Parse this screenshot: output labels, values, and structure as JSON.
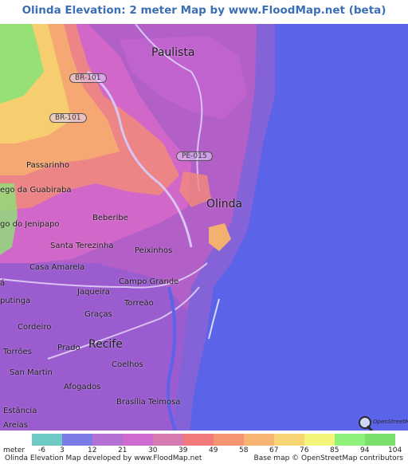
{
  "title": "Olinda Elevation: 2 meter Map by www.FloodMap.net (beta)",
  "map": {
    "places": [
      {
        "id": "paulista",
        "label": "Paulista"
      },
      {
        "id": "passarinho",
        "label": "Passarinho"
      },
      {
        "id": "corrego-guabiraba",
        "label": "ego da Guabiraba"
      },
      {
        "id": "corrego-jenipapo",
        "label": "go do Jenipapo"
      },
      {
        "id": "olinda",
        "label": "Olinda"
      },
      {
        "id": "beberibe",
        "label": "Beberibe"
      },
      {
        "id": "santa-terezinha",
        "label": "Santa Terezinha"
      },
      {
        "id": "peixinhos",
        "label": "Peixinhos"
      },
      {
        "id": "casa-amarela",
        "label": "Casa Amarela"
      },
      {
        "id": "campo-grande",
        "label": "Campo Grande"
      },
      {
        "id": "jaqueira",
        "label": "Jaqueira"
      },
      {
        "id": "apipucos",
        "label": "putinga"
      },
      {
        "id": "torreao",
        "label": "Torreão"
      },
      {
        "id": "cordeiro",
        "label": "Cordeiro"
      },
      {
        "id": "gracas",
        "label": "Graças"
      },
      {
        "id": "torroes",
        "label": "Torrões"
      },
      {
        "id": "prado",
        "label": "Prado"
      },
      {
        "id": "recife",
        "label": "Recife"
      },
      {
        "id": "san-martin",
        "label": "San Martin"
      },
      {
        "id": "coelhos",
        "label": "Coelhos"
      },
      {
        "id": "afogados",
        "label": "Afogados"
      },
      {
        "id": "estancia",
        "label": "Estância"
      },
      {
        "id": "brasilia-teimosa",
        "label": "Brasília Teimosa"
      },
      {
        "id": "areias",
        "label": "Areias"
      },
      {
        "id": "edge-a",
        "label": "á"
      }
    ],
    "road_shields": [
      {
        "id": "br101-north",
        "label": "BR-101"
      },
      {
        "id": "br101-south",
        "label": "BR-101"
      },
      {
        "id": "pe015",
        "label": "PE-015"
      }
    ],
    "osm_logo_text": "OpenStreetMap"
  },
  "legend": {
    "unit_label": "meter",
    "ticks": [
      "-6",
      "3",
      "12",
      "21",
      "30",
      "39",
      "49",
      "58",
      "67",
      "76",
      "85",
      "94",
      "104"
    ],
    "colors": [
      "#6ecac4",
      "#7b7be8",
      "#b36fd4",
      "#cf6bd0",
      "#d77ab0",
      "#f27a7a",
      "#f59472",
      "#f8b472",
      "#f7d474",
      "#f3f57a",
      "#8ef27a",
      "#79e06b"
    ]
  },
  "footer": {
    "left": "Olinda Elevation Map developed by www.FloodMap.net",
    "right": "Base map © OpenStreetMap contributors"
  }
}
